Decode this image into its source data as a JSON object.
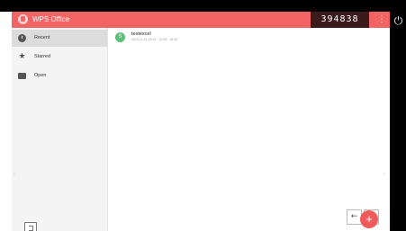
{
  "app": {
    "title": "WPS Office"
  },
  "overlay": {
    "number": "394838"
  },
  "icons": {
    "logo": "wps-logo-icon",
    "more": "more-vertical-icon",
    "power": "power-icon",
    "recent": "clock-icon",
    "starred": "star-icon",
    "open": "folder-icon",
    "exit": "exit-icon",
    "fab": "add-icon",
    "prev": "arrow-left-icon",
    "next": "arrow-right-icon"
  },
  "sidebar": {
    "items": [
      {
        "label": "Recent",
        "active": true
      },
      {
        "label": "Starred",
        "active": false
      },
      {
        "label": "Open",
        "active": false
      }
    ]
  },
  "files": [
    {
      "initial": "S",
      "name": "testexcel",
      "meta": "2019-11-21 15:24 · 10:08 · 16:30"
    }
  ],
  "nav": {
    "prev": "←",
    "next": "→"
  },
  "fab": {
    "label": "+"
  },
  "colors": {
    "accent": "#f26464",
    "sidebar": "#f4f4f4",
    "active_item": "#dcdcdc",
    "file_icon": "#5bbf7a"
  }
}
